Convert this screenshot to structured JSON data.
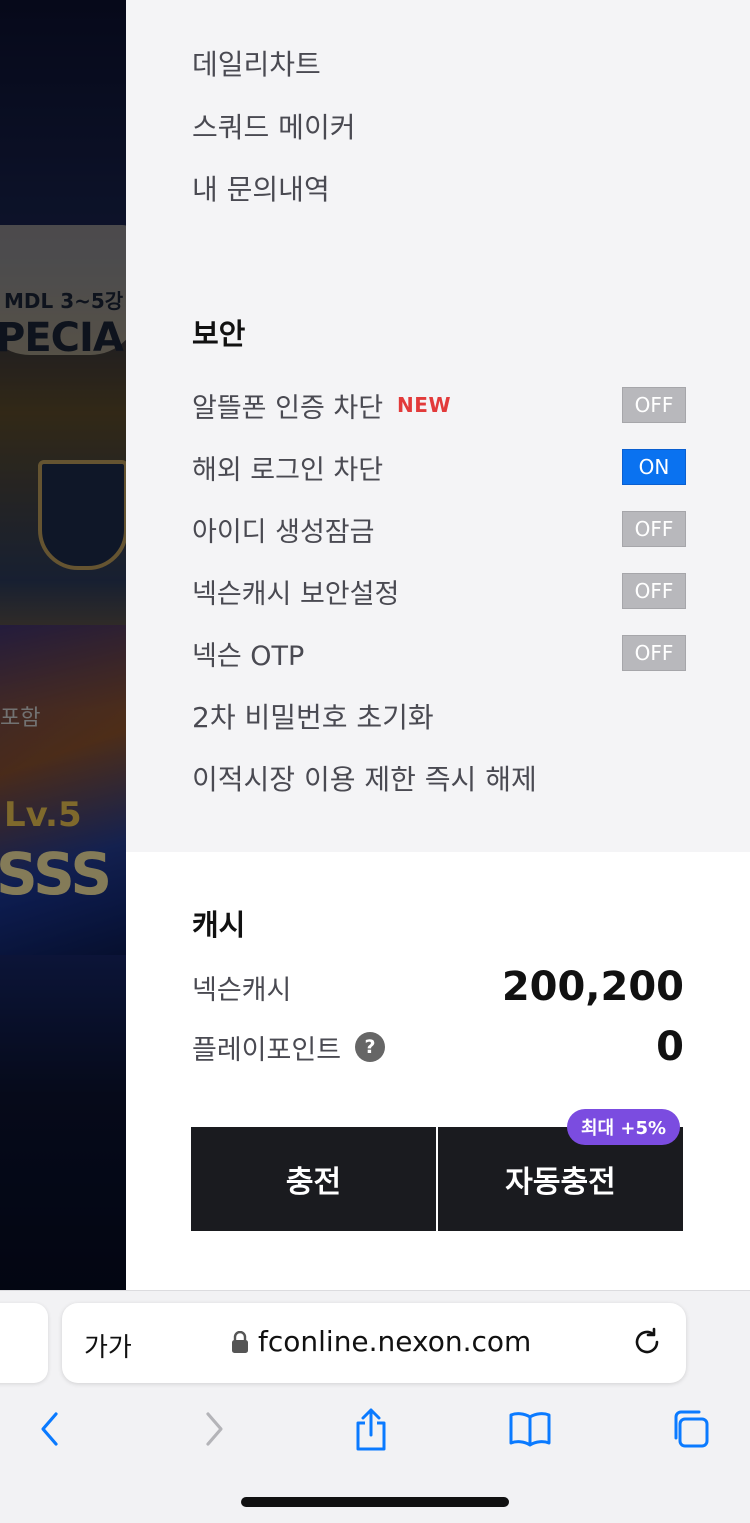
{
  "menu": {
    "items": [
      "데일리차트",
      "스쿼드 메이커",
      "내 문의내역"
    ]
  },
  "security": {
    "title": "보안",
    "rows": [
      {
        "label": "알뜰폰 인증 차단",
        "badge": "NEW",
        "toggle": "OFF"
      },
      {
        "label": "해외 로그인 차단",
        "badge": "",
        "toggle": "ON"
      },
      {
        "label": "아이디 생성잠금",
        "badge": "",
        "toggle": "OFF"
      },
      {
        "label": "넥슨캐시 보안설정",
        "badge": "",
        "toggle": "OFF"
      },
      {
        "label": "넥슨 OTP",
        "badge": "",
        "toggle": "OFF"
      }
    ],
    "links": [
      "2차 비밀번호 초기화",
      "이적시장 이용 제한 즉시 해제"
    ]
  },
  "cash": {
    "title": "캐시",
    "nexon_cash_label": "넥슨캐시",
    "nexon_cash_value": "200,200",
    "play_point_label": "플레이포인트",
    "play_point_value": "0",
    "help_glyph": "?",
    "charge_label": "충전",
    "auto_charge_label": "자동충전",
    "bonus_badge": "최대 +5%"
  },
  "background": {
    "line1": "MDL 3~5강",
    "line2": "PECIAL",
    "line3": "Lv.5",
    "line4": "SSS",
    "line5": "포함"
  },
  "browser": {
    "text_size_label": "가가",
    "url": "fconline.nexon.com"
  },
  "colors": {
    "toggle_on": "#0a72f0",
    "toggle_off": "#b8b8bc",
    "new_badge": "#e23a3a",
    "bonus_badge": "#7b4ce0",
    "button_bg": "#1a1b1f",
    "safari_icon": "#0a7aff"
  },
  "icons": {
    "help": "question-circle-icon",
    "lock": "lock-icon",
    "reload": "reload-icon",
    "back": "chevron-left-icon",
    "forward": "chevron-right-icon",
    "share": "share-icon",
    "bookmarks": "book-icon",
    "tabs": "tabs-icon"
  }
}
